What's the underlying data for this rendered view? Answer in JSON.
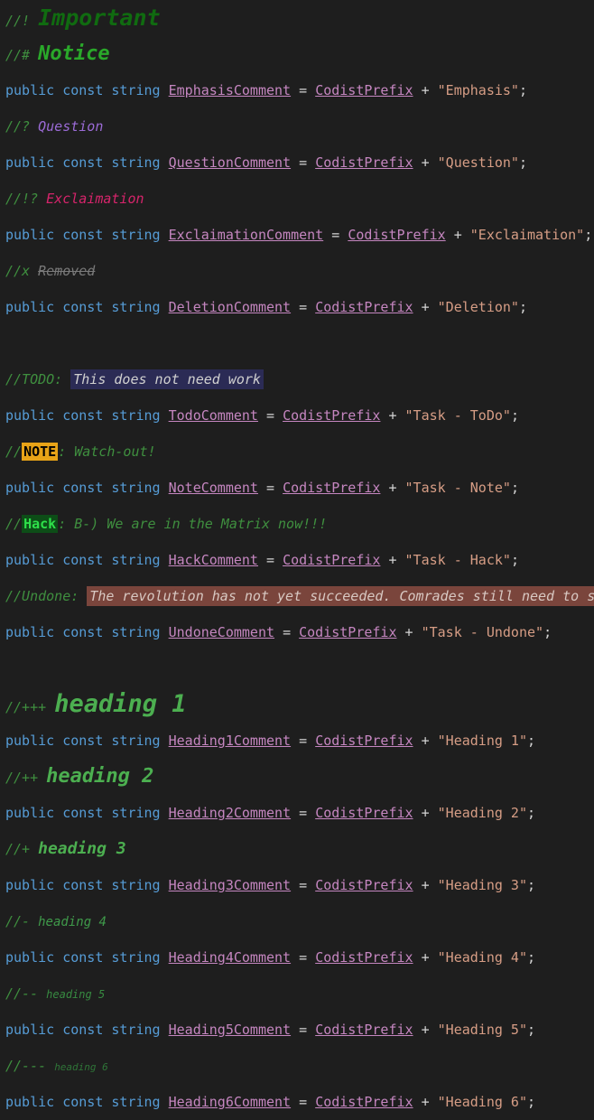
{
  "editor": {
    "background_color": "#1e1e1e",
    "language": "csharp",
    "colors": {
      "keyword": "#569cd6",
      "type": "#4ec9b0",
      "identifier": "#c586c0",
      "string": "#d69d85",
      "operator": "#d4d4d4",
      "comment_marker": "#3f8f3f",
      "important": "#106b10",
      "notice": "#2aa82a",
      "question": "#9b6bd6",
      "exclaimation": "#d6246b",
      "removed": "#7a7a7a",
      "todo_background": "#2b2b55",
      "note_badge_background": "#e8a317",
      "note_badge_text": "#000000",
      "hack_badge_background": "#0d4d17",
      "hack_badge_text": "#2ee04a",
      "undone_background": "#7a453c",
      "heading": "#4caf50"
    }
  },
  "tokens": {
    "public": "public",
    "const": "const",
    "string": "string",
    "equals": "=",
    "plus": "+",
    "semicolon": ";",
    "quote": "\"",
    "prefix": "CodistPrefix"
  },
  "lines": [
    {
      "kind": "comment",
      "marker": "//!",
      "text": "Important",
      "style": "important"
    },
    {
      "kind": "comment",
      "marker": "//#",
      "text": "Notice",
      "style": "notice"
    },
    {
      "kind": "code",
      "identifier": "EmphasisComment",
      "value": "Emphasis"
    },
    {
      "kind": "comment",
      "marker": "//?",
      "text": "Question",
      "style": "question"
    },
    {
      "kind": "code",
      "identifier": "QuestionComment",
      "value": "Question"
    },
    {
      "kind": "comment",
      "marker": "//!?",
      "text": "Exclaimation",
      "style": "exclaimation"
    },
    {
      "kind": "code",
      "identifier": "ExclaimationComment",
      "value": "Exclaimation"
    },
    {
      "kind": "comment",
      "marker": "//x",
      "text": "Removed",
      "style": "removed"
    },
    {
      "kind": "code",
      "identifier": "DeletionComment",
      "value": "Deletion"
    },
    {
      "kind": "blank"
    },
    {
      "kind": "comment",
      "marker": "//TODO:",
      "text": "This does not need work",
      "style": "todo"
    },
    {
      "kind": "code",
      "identifier": "TodoComment",
      "value": "Task - ToDo"
    },
    {
      "kind": "comment",
      "marker": "//",
      "badge": "NOTE",
      "text": ": Watch-out!",
      "style": "note"
    },
    {
      "kind": "code",
      "identifier": "NoteComment",
      "value": "Task - Note"
    },
    {
      "kind": "comment",
      "marker": "//",
      "badge": "Hack",
      "text": ": B-) We are in the Matrix now!!!",
      "style": "hack"
    },
    {
      "kind": "code",
      "identifier": "HackComment",
      "value": "Task - Hack"
    },
    {
      "kind": "comment",
      "marker": "//Undone:",
      "text": "The revolution has not yet succeeded. Comrades still need to strive hard.",
      "style": "undone"
    },
    {
      "kind": "code",
      "identifier": "UndoneComment",
      "value": "Task - Undone"
    },
    {
      "kind": "blank"
    },
    {
      "kind": "comment",
      "marker": "//+++",
      "text": "heading 1",
      "style": "h1"
    },
    {
      "kind": "code",
      "identifier": "Heading1Comment",
      "value": "Heading 1"
    },
    {
      "kind": "comment",
      "marker": "//++",
      "text": "heading 2",
      "style": "h2"
    },
    {
      "kind": "code",
      "identifier": "Heading2Comment",
      "value": "Heading 2"
    },
    {
      "kind": "comment",
      "marker": "//+",
      "text": "heading 3",
      "style": "h3"
    },
    {
      "kind": "code",
      "identifier": "Heading3Comment",
      "value": "Heading 3"
    },
    {
      "kind": "comment",
      "marker": "//-",
      "text": "heading 4",
      "style": "h4"
    },
    {
      "kind": "code",
      "identifier": "Heading4Comment",
      "value": "Heading 4"
    },
    {
      "kind": "comment",
      "marker": "//--",
      "text": "heading 5",
      "style": "h5"
    },
    {
      "kind": "code",
      "identifier": "Heading5Comment",
      "value": "Heading 5"
    },
    {
      "kind": "comment",
      "marker": "//---",
      "text": "heading 6",
      "style": "h6"
    },
    {
      "kind": "code",
      "identifier": "Heading6Comment",
      "value": "Heading 6"
    }
  ]
}
